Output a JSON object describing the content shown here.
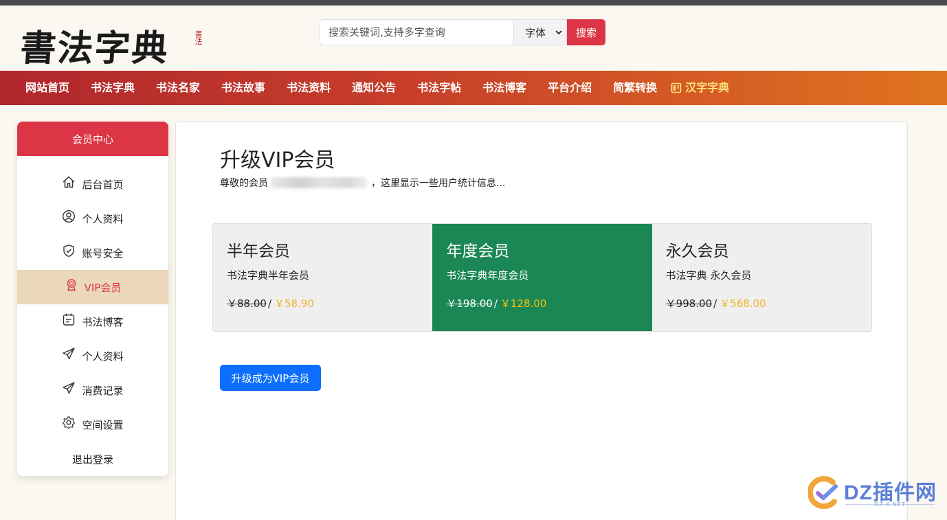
{
  "header": {
    "logo_text": "書法字典",
    "logo_seal": "書法",
    "search_placeholder": "搜索关键词,支持多字查询",
    "search_select": "字体",
    "search_button": "搜索"
  },
  "nav": {
    "items": [
      "网站首页",
      "书法字典",
      "书法名家",
      "书法故事",
      "书法资料",
      "通知公告",
      "书法字帖",
      "书法博客",
      "平台介绍",
      "简繁转换"
    ],
    "highlight": "汉字字典"
  },
  "sidebar": {
    "title": "会员中心",
    "items": [
      {
        "label": "后台首页",
        "icon": "house-icon"
      },
      {
        "label": "个人资料",
        "icon": "user-circle-icon"
      },
      {
        "label": "账号安全",
        "icon": "shield-check-icon"
      },
      {
        "label": "VIP会员",
        "icon": "award-icon",
        "active": true
      },
      {
        "label": "书法博客",
        "icon": "calendar-icon"
      },
      {
        "label": "个人资料",
        "icon": "send-icon"
      },
      {
        "label": "消费记录",
        "icon": "send-icon"
      },
      {
        "label": "空间设置",
        "icon": "gear-icon"
      }
    ],
    "logout": "退出登录"
  },
  "main": {
    "title": "升级VIP会员",
    "welcome_prefix": "尊敬的会员",
    "welcome_suffix": "，这里显示一些用户统计信息...",
    "plans": [
      {
        "name": "半年会员",
        "desc": "书法字典半年会员",
        "old_price": "￥88.00",
        "sep": "/",
        "new_price": "￥58.90"
      },
      {
        "name": "年度会员",
        "desc": "书法字典年度会员",
        "old_price": "￥198.00",
        "sep": "/",
        "new_price": "￥128.00"
      },
      {
        "name": "永久会员",
        "desc": "书法字典 永久会员",
        "old_price": "￥998.00",
        "sep": "/",
        "new_price": "￥568.00"
      }
    ],
    "upgrade_button": "升级成为VIP会员"
  },
  "watermark": {
    "text": "DZ插件网",
    "sub": "DZ-X.NET"
  },
  "colors": {
    "accent": "#dc3545",
    "featured": "#1a8754",
    "primary": "#0d6efd",
    "active_bg": "#ead8b8",
    "price": "#f0b429"
  }
}
